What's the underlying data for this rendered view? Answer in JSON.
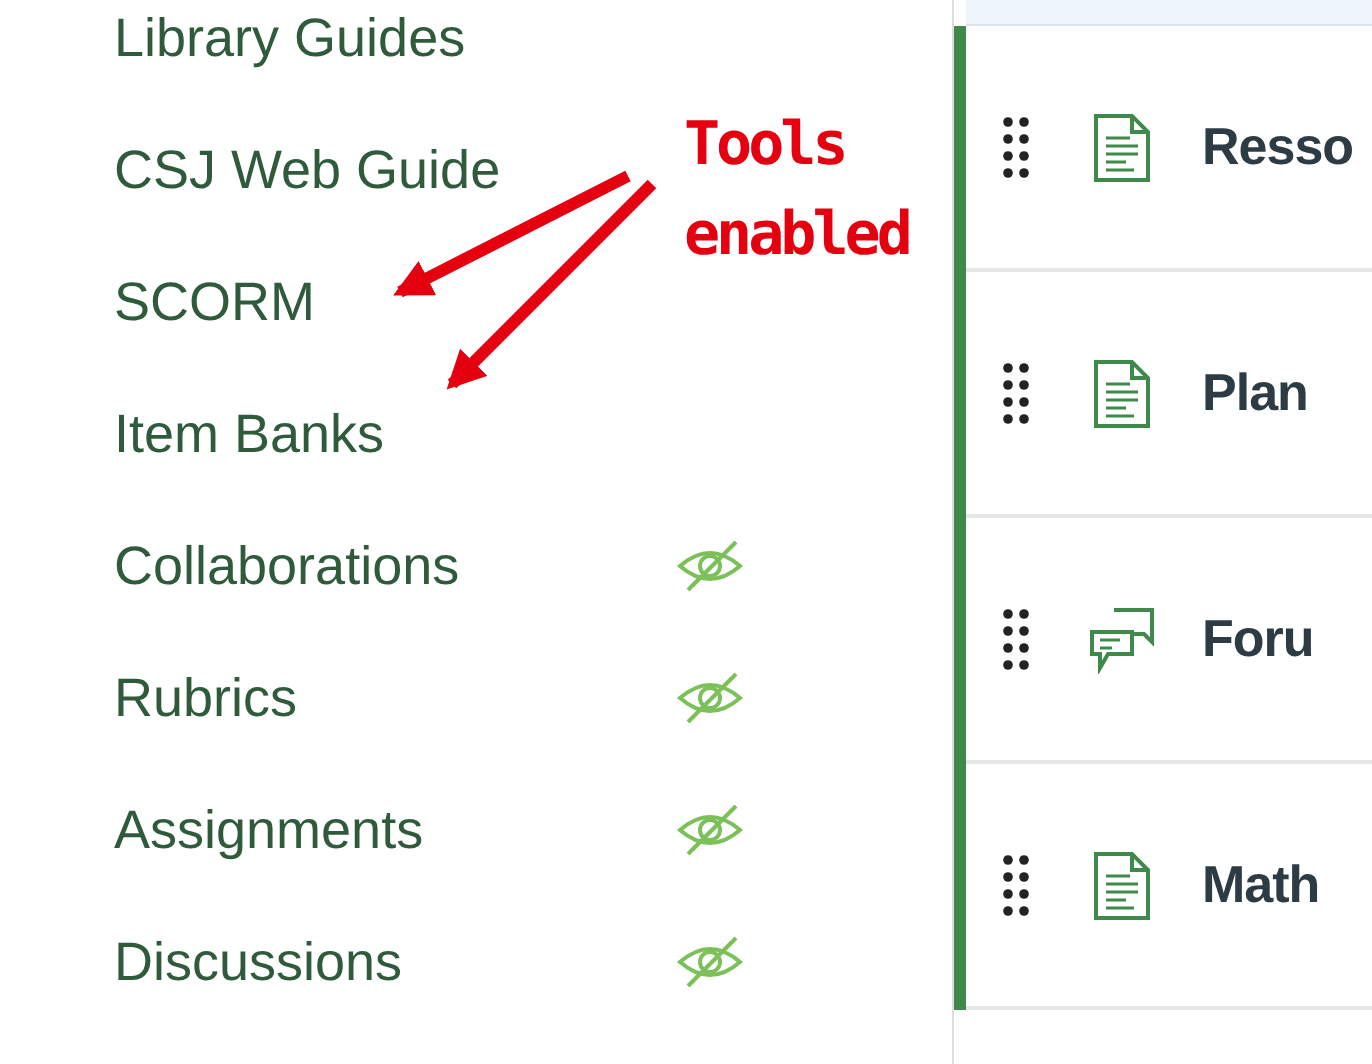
{
  "course_nav": {
    "items": [
      {
        "label": "Library Guides",
        "hidden": false
      },
      {
        "label": "CSJ Web Guide",
        "hidden": false
      },
      {
        "label": "SCORM",
        "hidden": false
      },
      {
        "label": "Item Banks",
        "hidden": false
      },
      {
        "label": "Collaborations",
        "hidden": true
      },
      {
        "label": "Rubrics",
        "hidden": true
      },
      {
        "label": "Assignments",
        "hidden": true
      },
      {
        "label": "Discussions",
        "hidden": true
      }
    ]
  },
  "annotation": {
    "text": "Tools enabled"
  },
  "module": {
    "items": [
      {
        "kind": "page",
        "title": "Resso"
      },
      {
        "kind": "page",
        "title": "Plan"
      },
      {
        "kind": "discussion",
        "title": "Foru"
      },
      {
        "kind": "page",
        "title": "Math"
      }
    ]
  }
}
